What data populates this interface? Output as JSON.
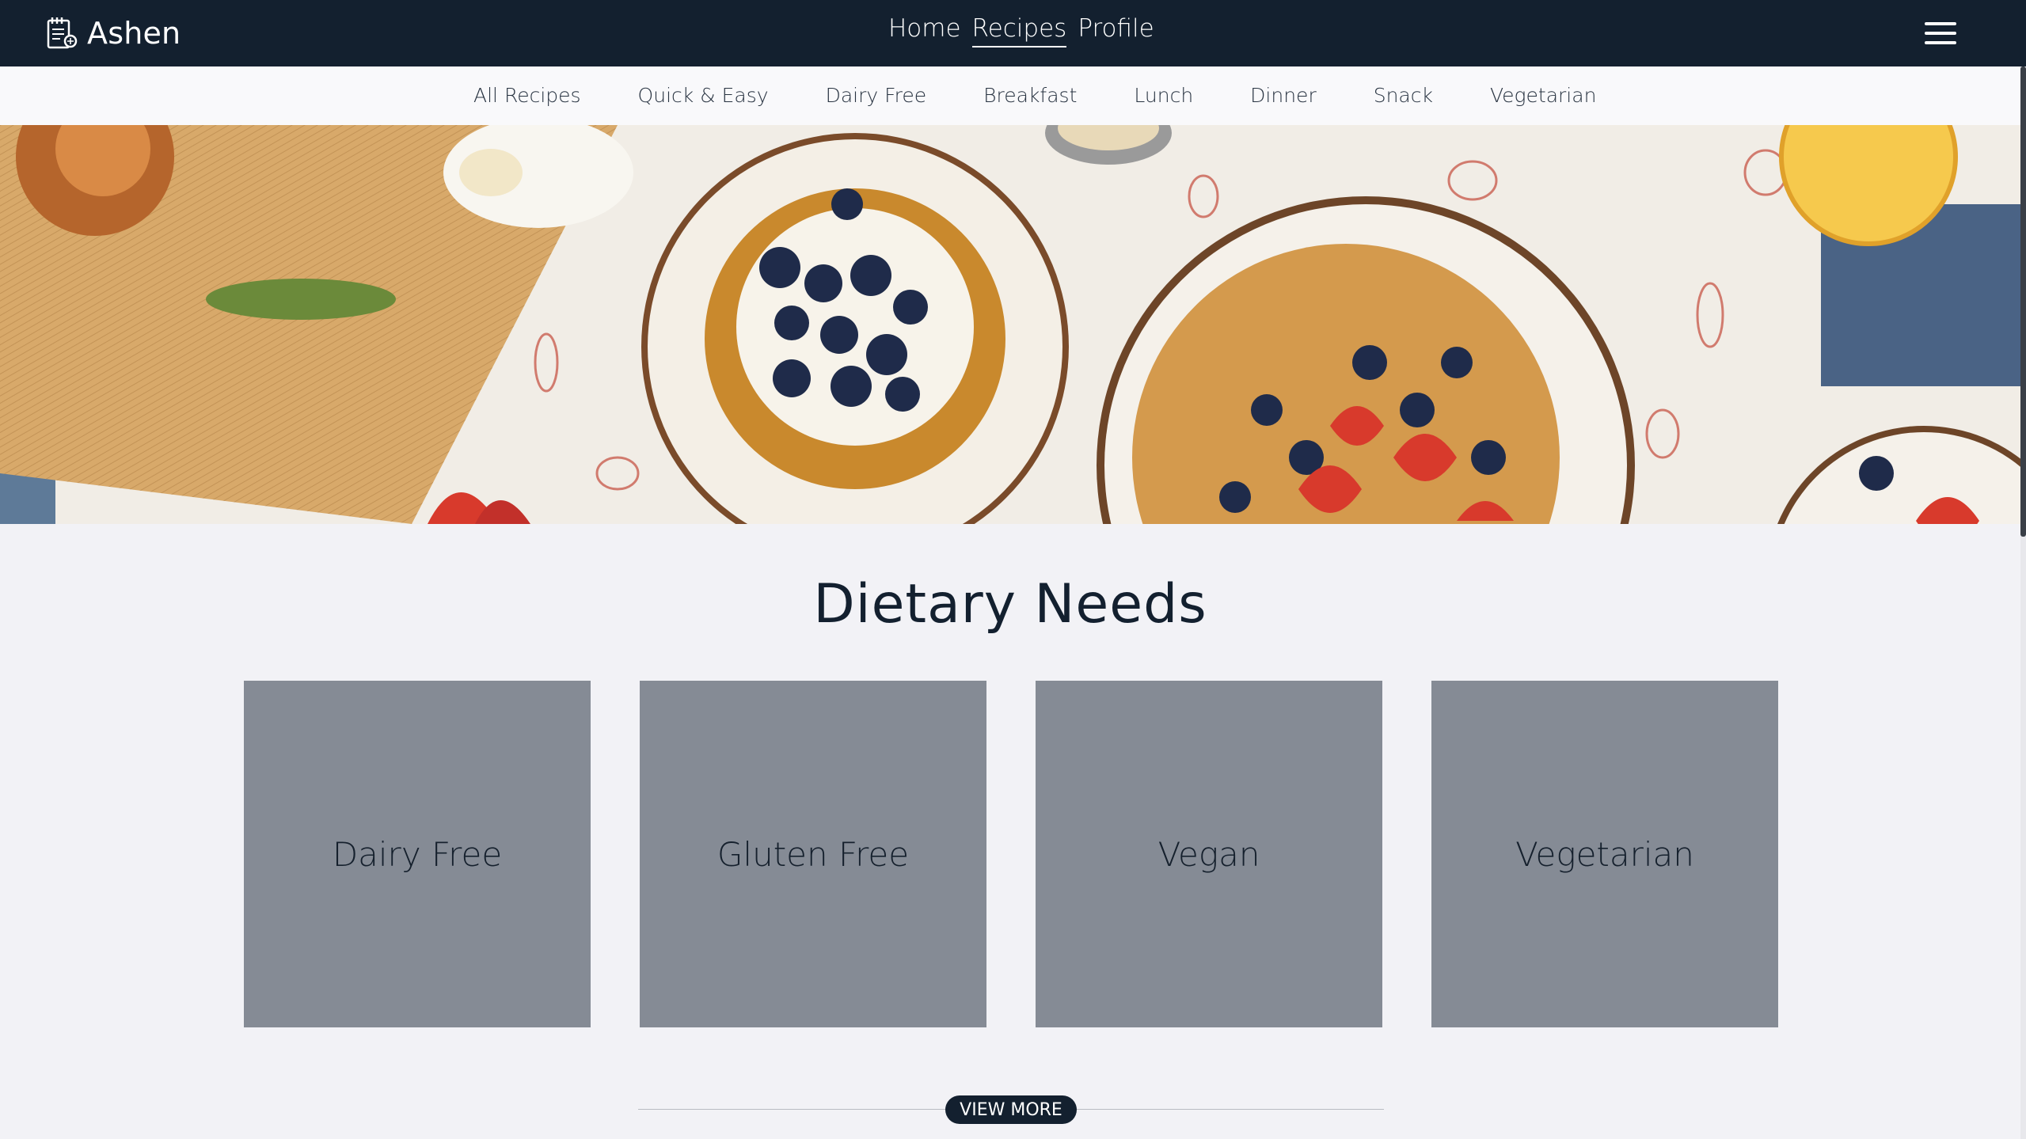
{
  "header": {
    "brand": "Ashen",
    "nav": [
      {
        "label": "Home"
      },
      {
        "label": "Recipes",
        "active": true
      },
      {
        "label": "Profile"
      }
    ]
  },
  "categories": [
    "All Recipes",
    "Quick & Easy",
    "Dairy Free",
    "Breakfast",
    "Lunch",
    "Dinner",
    "Snack",
    "Vegetarian"
  ],
  "hero": {
    "image_description": "breakfast table with pancakes, waffles, blueberries and strawberries"
  },
  "section": {
    "title": "Dietary Needs",
    "cards": [
      "Dairy Free",
      "Gluten Free",
      "Vegan",
      "Vegetarian"
    ],
    "view_more": "VIEW MORE"
  },
  "colors": {
    "header_bg": "#13202f",
    "page_bg": "#f2f2f6",
    "card_bg": "#858b95",
    "accent": "#13202f"
  },
  "icons": [
    "notebook-recipe-icon",
    "hamburger-menu-icon"
  ]
}
